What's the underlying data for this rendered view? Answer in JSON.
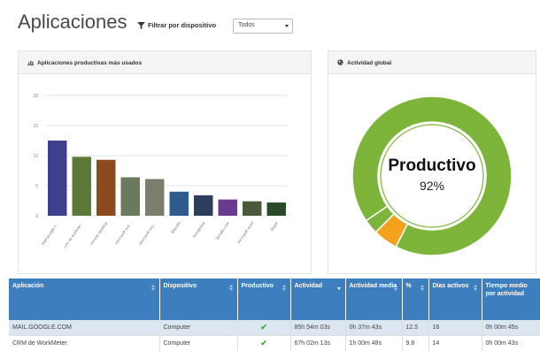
{
  "header": {
    "title": "Aplicaciones",
    "filter_label": "Filtrar por dispositivo",
    "filter_value": "Todos",
    "filter_icon": "filter-icon"
  },
  "panels": {
    "left_title": "Aplicaciones productivas más usados",
    "left_icon": "bar-chart-icon",
    "right_title": "Actividad global",
    "right_icon": "globe-icon"
  },
  "chart_data": [
    {
      "type": "bar",
      "title": "Aplicaciones productivas más usados",
      "categories": [
        "mail.google.com",
        "crm de workmeter",
        "remote desktop",
        "microsoft outlook",
        "microsoft excel",
        "linkedin",
        "wordpress",
        "google.com",
        "microsoft word",
        "skype"
      ],
      "values": [
        12.5,
        9.8,
        9.3,
        6.4,
        6.1,
        4.0,
        3.4,
        2.7,
        2.4,
        2.2
      ],
      "colors": [
        "#3f3f8f",
        "#5b7a3a",
        "#8b4a1e",
        "#6b7a5e",
        "#7d7d6e",
        "#2e5a8e",
        "#2c3e5c",
        "#6a3a8e",
        "#4a5a3a",
        "#2a4a2a"
      ],
      "yticks": [
        "0",
        "5",
        "10",
        "15",
        "20"
      ],
      "ylim": [
        0,
        20
      ],
      "grid": true
    },
    {
      "type": "pie",
      "variant": "donut",
      "center_label": "Productivo",
      "center_value": "92%",
      "slices": [
        {
          "value": 92,
          "color": "#7cb53a"
        },
        {
          "value": 5,
          "color": "#f4a11e"
        },
        {
          "value": 3,
          "color": "#7cb53a"
        }
      ]
    }
  ],
  "table": {
    "headers": [
      {
        "label": "Aplicación",
        "sort": "both"
      },
      {
        "label": "Dispositivo",
        "sort": "both"
      },
      {
        "label": "Productivo",
        "sort": "both"
      },
      {
        "label": "Actividad",
        "sort": "desc"
      },
      {
        "label": "Actividad media",
        "sort": "both"
      },
      {
        "label": "%",
        "sort": "both"
      },
      {
        "label": "Días activos",
        "sort": "both"
      },
      {
        "label": "Tiempo medio por actividad",
        "sort": "none"
      }
    ],
    "rows": [
      [
        "MAIL.GOOGLE.COM",
        "Computer",
        "check",
        "85h 54m 03s",
        "0h 37m 43s",
        "12.5",
        "16",
        "0h 00m 45s"
      ],
      [
        "CRM de WorkMeter",
        "Computer",
        "check",
        "67h 02m 13s",
        "1h 00m 48s",
        "9.8",
        "14",
        "0h 00m 43s"
      ]
    ]
  }
}
